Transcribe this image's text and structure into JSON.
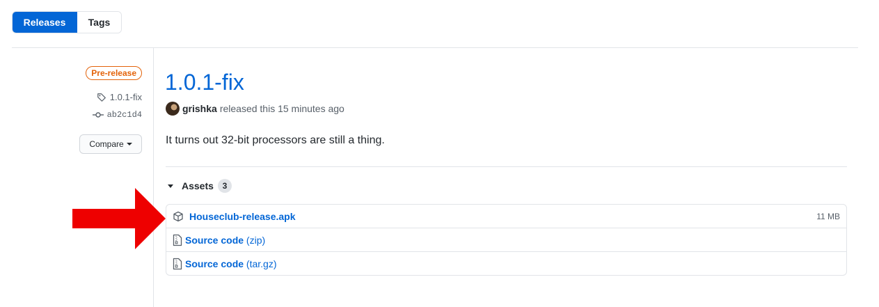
{
  "nav": {
    "releases_label": "Releases",
    "tags_label": "Tags"
  },
  "meta": {
    "prerelease_label": "Pre-release",
    "tag_name": "1.0.1-fix",
    "commit": "ab2c1d4",
    "compare_label": "Compare"
  },
  "release": {
    "title": "1.0.1-fix",
    "author": "grishka",
    "released_text": "released this 15 minutes ago",
    "body": "It turns out 32-bit processors are still a thing."
  },
  "assets": {
    "heading": "Assets",
    "count": "3",
    "items": [
      {
        "name": "Houseclub-release.apk",
        "size": "11 MB",
        "icon": "package-icon"
      },
      {
        "name": "Source code",
        "format": "(zip)",
        "icon": "file-zip-icon"
      },
      {
        "name": "Source code",
        "format": "(tar.gz)",
        "icon": "file-zip-icon"
      }
    ]
  },
  "colors": {
    "accent": "#0366d6",
    "prerelease": "#e36209",
    "annotation_arrow": "#ee0000"
  }
}
